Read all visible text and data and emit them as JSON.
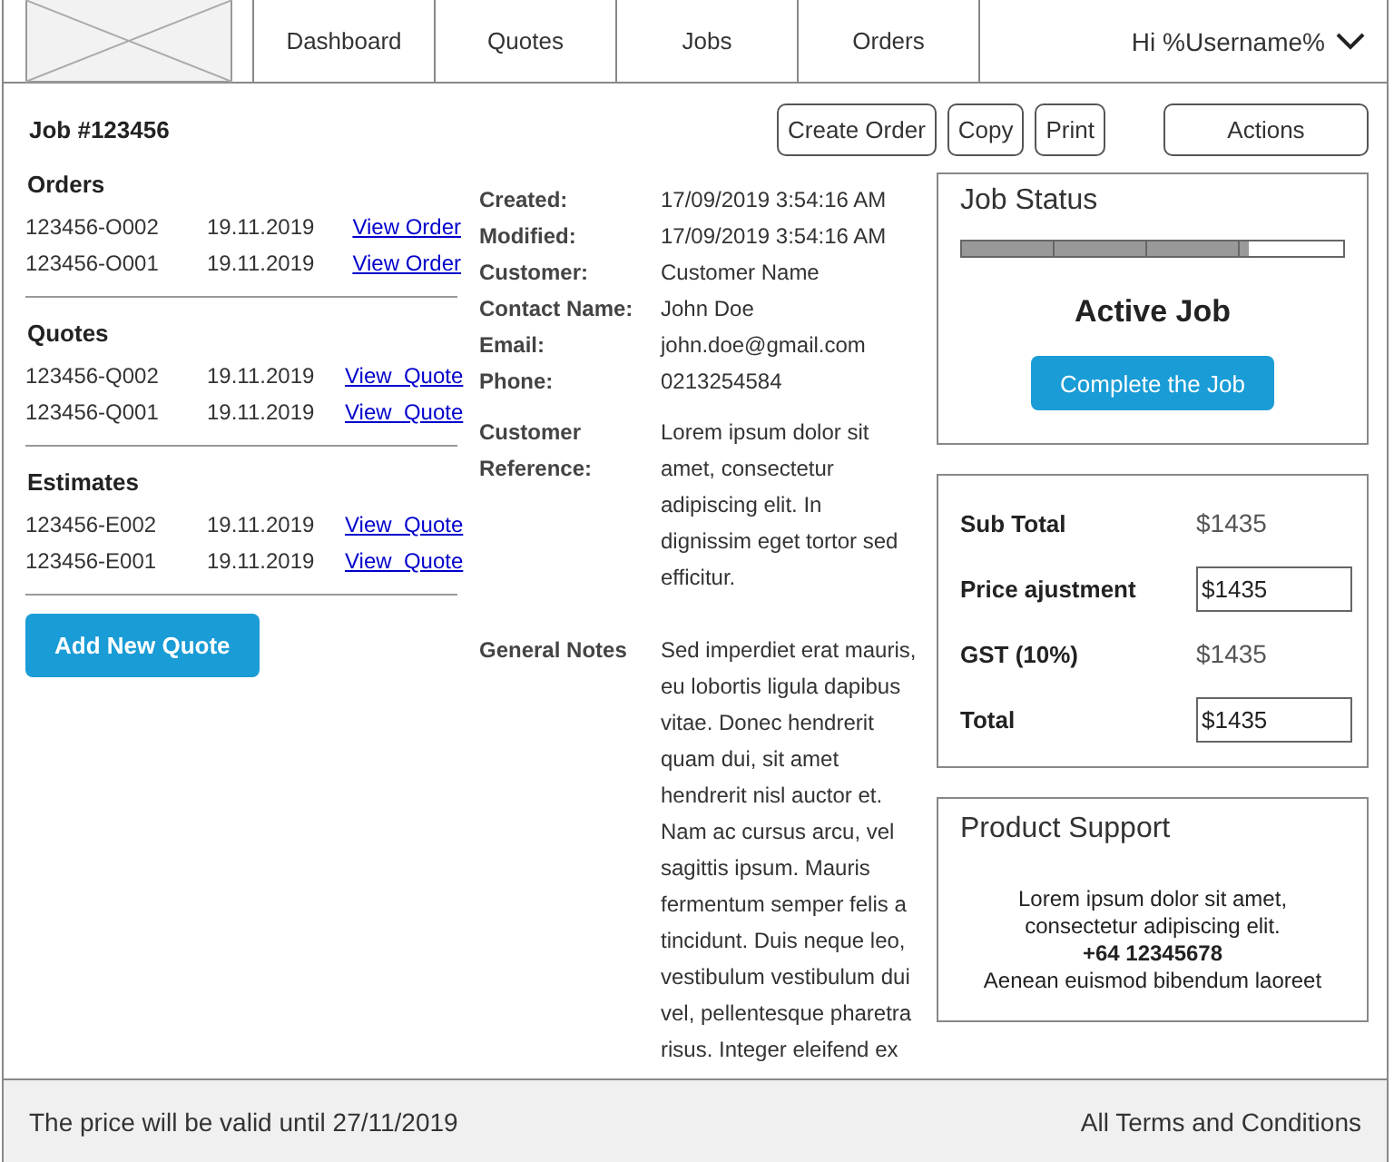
{
  "nav": {
    "tabs": [
      {
        "label": "Dashboard"
      },
      {
        "label": "Quotes"
      },
      {
        "label": "Jobs"
      },
      {
        "label": "Orders"
      }
    ],
    "greeting": "Hi %Username%"
  },
  "job": {
    "title": "Job #123456",
    "buttons": [
      "Create Order",
      "Copy",
      "Print"
    ],
    "actions": "Actions"
  },
  "sections": [
    {
      "title": "Orders",
      "rows": [
        {
          "id": "123456-O002",
          "date": "19.11.2019",
          "link": "View Order"
        },
        {
          "id": "123456-O001",
          "date": "19.11.2019",
          "link": "View Order"
        }
      ]
    },
    {
      "title": "Quotes",
      "rows": [
        {
          "id": "123456-Q002",
          "date": "19.11.2019",
          "link": "View  Quote"
        },
        {
          "id": "123456-Q001",
          "date": "19.11.2019",
          "link": "View  Quote"
        }
      ]
    },
    {
      "title": "Estimates",
      "rows": [
        {
          "id": "123456-E002",
          "date": "19.11.2019",
          "link": "View  Quote"
        },
        {
          "id": "123456-E001",
          "date": "19.11.2019",
          "link": "View  Quote"
        }
      ]
    }
  ],
  "add_button": "Add New Quote",
  "details": [
    {
      "label": "Created:",
      "value": "17/09/2019 3:54:16 AM"
    },
    {
      "label": "Modified:",
      "value": "17/09/2019 3:54:16 AM"
    },
    {
      "label": "Customer:",
      "value": "Customer Name"
    },
    {
      "label": "Contact Name:",
      "value": "John Doe"
    },
    {
      "label": "Email:",
      "value": "john.doe@gmail.com"
    },
    {
      "label": "Phone:",
      "value": "0213254584"
    },
    {
      "label": "Customer Reference:",
      "value": "Lorem ipsum dolor sit amet, consectetur adipiscing elit. In dignissim eget tortor sed efficitur.",
      "kind": "block"
    },
    {
      "label": "General Notes",
      "value": "Sed imperdiet erat mauris, eu lobortis ligula dapibus vitae. Donec hendrerit quam dui, sit amet hendrerit nisl auctor et. Nam ac cursus arcu, vel sagittis ipsum. Mauris fermentum semper felis a tincidunt. Duis neque leo, vestibulum vestibulum dui vel, pellentesque pharetra risus. Integer eleifend ex",
      "kind": "block"
    }
  ],
  "status": {
    "title": "Job Status",
    "level": 0.75,
    "label": "Active Job",
    "button": "Complete the Job"
  },
  "totals": [
    {
      "label": "Sub Total",
      "value": "$1435",
      "kind": "text"
    },
    {
      "label": "Price ajustment",
      "value": "$1435",
      "kind": "input"
    },
    {
      "label": "GST (10%)",
      "value": "$1435",
      "kind": "text"
    },
    {
      "label": "Total",
      "value": "$1435",
      "kind": "input"
    }
  ],
  "support": {
    "title": "Product Support",
    "lines": [
      {
        "text": "Lorem ipsum dolor sit amet,",
        "bold": false
      },
      {
        "text": "consectetur adipiscing elit.",
        "bold": false
      },
      {
        "text": "+64 12345678",
        "bold": true
      },
      {
        "text": "Aenean euismod bibendum laoreet",
        "bold": false
      }
    ]
  },
  "footer": {
    "validity": "The price will be valid until 27/11/2019",
    "terms": "All Terms and Conditions"
  }
}
